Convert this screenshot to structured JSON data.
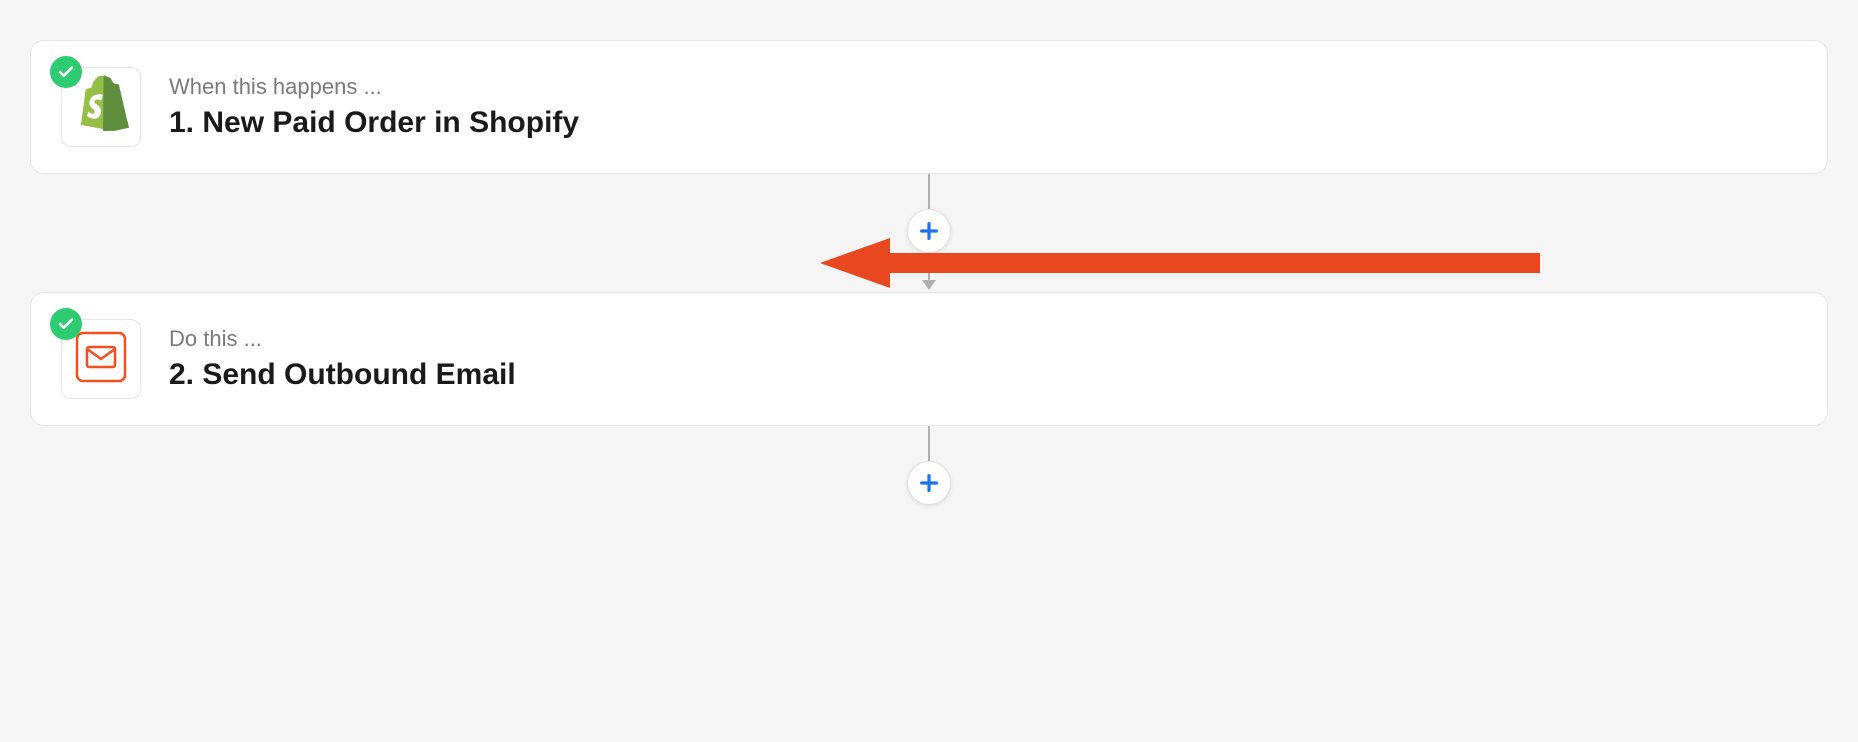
{
  "steps": [
    {
      "subtitle": "When this happens ...",
      "title": "1. New Paid Order in Shopify",
      "app_icon": "shopify",
      "status": "ok"
    },
    {
      "subtitle": "Do this ...",
      "title": "2. Send Outbound Email",
      "app_icon": "email",
      "status": "ok"
    }
  ],
  "colors": {
    "accent_blue": "#1a73e8",
    "status_ok": "#2ecc71",
    "annotation": "#e8471f",
    "shopify_green": "#5e8e3e",
    "email_orange": "#f24e1e"
  }
}
